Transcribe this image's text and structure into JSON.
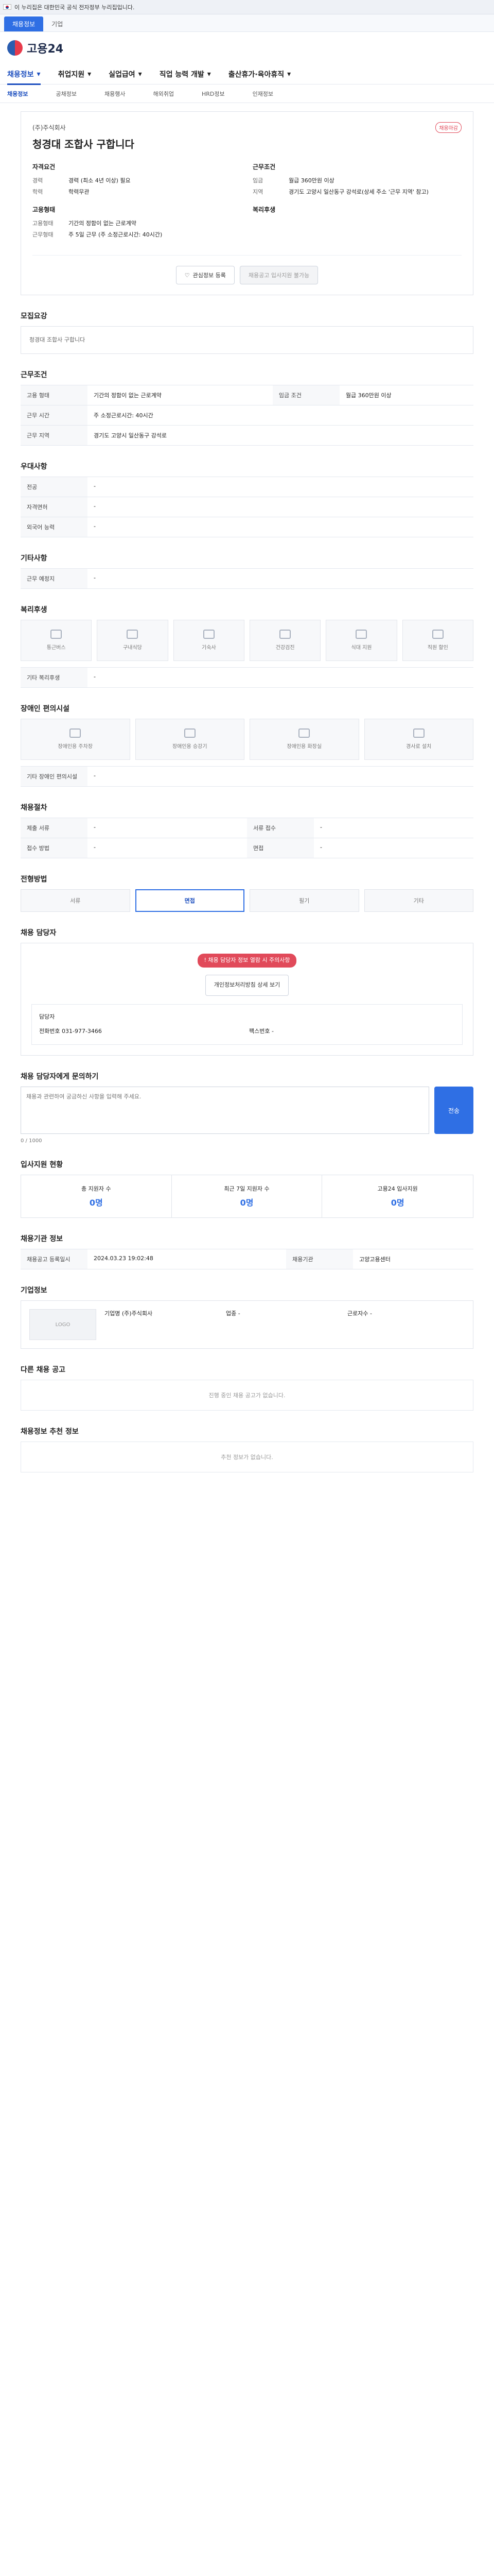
{
  "govbar": {
    "text": "이 누리집은 대한민국 공식 전자정부 누리집입니다."
  },
  "tabs": [
    "채용정보",
    "기업"
  ],
  "brand": {
    "name": "고용24"
  },
  "nav": [
    "채용정보",
    "취업지원",
    "실업급여",
    "직업 능력 개발",
    "출산휴가·육아휴직"
  ],
  "subnav": [
    "채용정보",
    "공채정보",
    "채용행사",
    "해외취업",
    "HRD정보",
    "인재정보"
  ],
  "hero": {
    "company": "(주)주식회사",
    "badge": "채용마감",
    "title": "청경대 조합사 구합니다",
    "left_title": "자격요건",
    "left": [
      {
        "k": "경력",
        "v": "경력 (최소 4년 이상) 필요"
      },
      {
        "k": "학력",
        "v": "학력무관"
      }
    ],
    "left2_title": "고용형태",
    "left2": [
      {
        "k": "고용형태",
        "v": "기간의 정함이 없는 근로계약"
      },
      {
        "k": "근무형태",
        "v": "주 5일 근무 (주 소정근로시간: 40시간)"
      }
    ],
    "right_title": "근무조건",
    "right": [
      {
        "k": "임금",
        "v": "월급 360만원 이상"
      },
      {
        "k": "지역",
        "v": "경기도 고양시 일산동구 강석로(상세 주소 '근무 지역' 참고)"
      }
    ],
    "right2_title": "복리후생",
    "right2": [],
    "btn_save": "관심정보 등록",
    "btn_share": "채용공고 입사지원 불가능"
  },
  "sec_recruit": {
    "title": "모집요강",
    "body": "청경대 조합사 구합니다"
  },
  "sec_conditions": {
    "title": "근무조건"
  },
  "sec_requirements": {
    "title": "우대사항"
  },
  "sec_extra": {
    "title": "기타사항"
  },
  "sec_welfare": {
    "title": "복리후생",
    "items": [
      "통근버스",
      "구내식당",
      "기숙사",
      "건강검진",
      "식대 지원",
      "직원 할인"
    ],
    "etc_label": "기타 복리후생"
  },
  "sec_disab": {
    "title": "장애인 편의시설",
    "items": [
      "장애인용 주차장",
      "장애인용 승강기",
      "장애인용 화장실",
      "경사로 설치"
    ],
    "etc_label": "기타 장애인 편의시설"
  },
  "sec_process": {
    "title": "채용절차"
  },
  "sec_method": {
    "title": "전형방법",
    "steps": [
      "서류",
      "면접",
      "필기",
      "기타"
    ]
  },
  "sec_contact": {
    "title": "채용 담당자",
    "alert": "채용 담당자 정보 열람 시 주의사항",
    "btn": "개인정보처리방침 상세 보기",
    "name_label": "담당자",
    "phone_label": "전화번호",
    "phone": "031-977-3466",
    "fax_label": "팩스번호",
    "fax": "-"
  },
  "sec_qa": {
    "title": "채용 담당자에게 문의하기",
    "placeholder": "채용과 관련하여 궁금하신 사항을 입력해 주세요.",
    "submit": "전송",
    "count": "0 / 1000"
  },
  "sec_stats": {
    "title": "입사지원 현황",
    "items": [
      {
        "label": "총 지원자 수",
        "v": "0명"
      },
      {
        "label": "최근 7일 지원자 수",
        "v": "0명"
      },
      {
        "label": "고용24 입사지원",
        "v": "0명"
      }
    ]
  },
  "sec_info": {
    "title": "채용기관 정보",
    "rows": [
      {
        "k": "채용공고 등록일시",
        "v": "2024.03.23 19:02:48"
      },
      {
        "k": "채용기관",
        "v": "고양고용센터"
      }
    ]
  },
  "sec_company": {
    "title": "기업정보",
    "logo": "LOGO",
    "items": [
      {
        "k": "기업명",
        "v": "(주)주식회사"
      },
      {
        "k": "업종",
        "v": "-"
      },
      {
        "k": "근로자수",
        "v": "-"
      }
    ]
  },
  "sec_same": {
    "title": "다른 채용 공고",
    "empty": "진행 중인 채용 공고가 없습니다."
  },
  "sec_similar": {
    "title": "채용정보 추천 정보",
    "empty": "추천 정보가 없습니다."
  }
}
